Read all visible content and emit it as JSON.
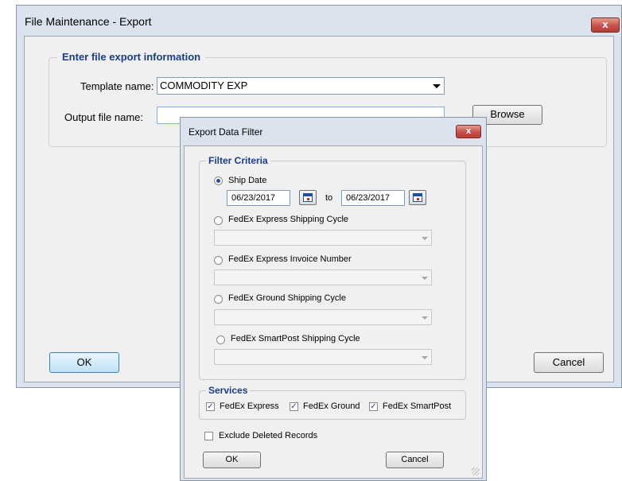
{
  "main_window": {
    "title": "File Maintenance - Export",
    "close_glyph": "x",
    "group_title": "Enter file export information",
    "template_label": "Template name:",
    "template_value": "COMMODITY EXP",
    "output_label": "Output file name:",
    "output_value": "",
    "browse_label": "Browse",
    "ok_label": "OK",
    "cancel_label": "Cancel"
  },
  "filter_dialog": {
    "title": "Export Data Filter",
    "close_glyph": "x",
    "filter_group_title": "Filter Criteria",
    "ship_date": {
      "label": "Ship Date",
      "selected": true,
      "from": "06/23/2017",
      "to_label": "to",
      "to": "06/23/2017"
    },
    "express_cycle_label": "FedEx Express Shipping Cycle",
    "express_invoice_label": "FedEx Express Invoice Number",
    "ground_cycle_label": "FedEx Ground Shipping Cycle",
    "smartpost_cycle_label": "FedEx SmartPost Shipping Cycle",
    "services_title": "Services",
    "services": [
      {
        "label": "FedEx Express",
        "checked": true
      },
      {
        "label": "FedEx Ground",
        "checked": true
      },
      {
        "label": "FedEx SmartPost",
        "checked": true
      }
    ],
    "exclude_deleted_label": "Exclude Deleted Records",
    "exclude_deleted_checked": false,
    "ok_label": "OK",
    "cancel_label": "Cancel"
  }
}
